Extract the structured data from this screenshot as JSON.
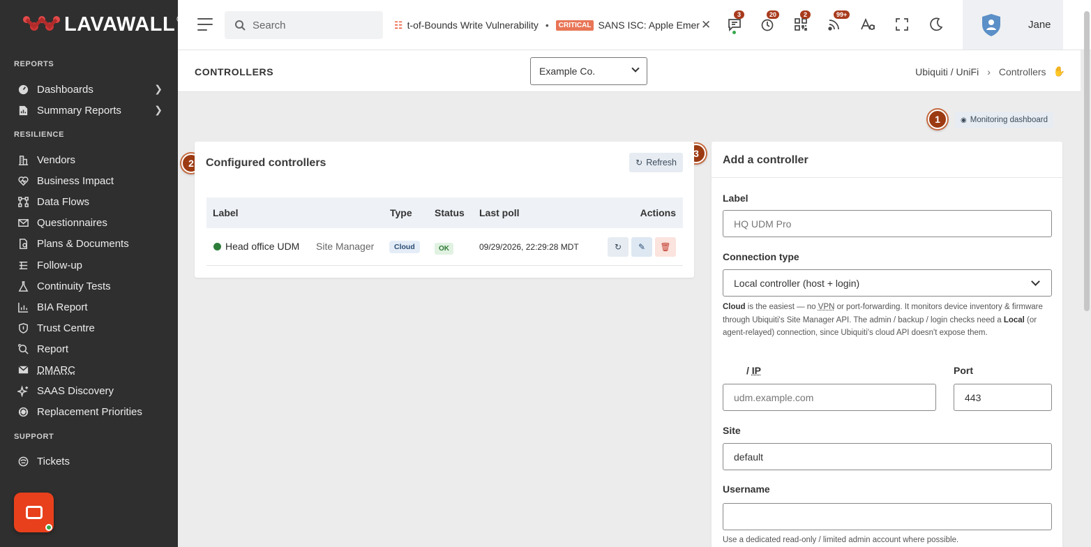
{
  "brand": {
    "name": "LAVAWALL",
    "reg": "®"
  },
  "sidebar": {
    "sections": [
      {
        "title": "REPORTS"
      },
      {
        "title": "RESILIENCE"
      },
      {
        "title": "SUPPORT"
      }
    ],
    "items": [
      {
        "label": "Dashboards",
        "icon": "dashboard-icon"
      },
      {
        "label": "Summary Reports",
        "icon": "report-icon"
      },
      {
        "label": "Vendors",
        "icon": "building-icon"
      },
      {
        "label": "Business Impact",
        "icon": "heart-icon"
      },
      {
        "label": "Data Flows",
        "icon": "flow-icon"
      },
      {
        "label": "Questionnaires",
        "icon": "mail-icon"
      },
      {
        "label": "Plans & Documents",
        "icon": "document-icon"
      },
      {
        "label": "Follow-up",
        "icon": "list-icon"
      },
      {
        "label": "Continuity Tests",
        "icon": "flask-icon"
      },
      {
        "label": "BIA Report",
        "icon": "chart-icon"
      },
      {
        "label": "Trust Centre",
        "icon": "shield-icon"
      },
      {
        "label": "Report",
        "icon": "search-icon"
      },
      {
        "label": "DMARC",
        "icon": "envelope-check-icon"
      },
      {
        "label": "SAAS Discovery",
        "icon": "sparkle-icon"
      },
      {
        "label": "Replacement Priorities",
        "icon": "cycle-icon"
      },
      {
        "label": "Tickets",
        "icon": "ticket-icon"
      }
    ]
  },
  "topbar": {
    "search_placeholder": "Search",
    "ticker_item_1": "t-of-Bounds Write Vulnerability",
    "ticker_badge": "CRITICAL",
    "ticker_item_2": "SANS ISC: Apple Emer",
    "badges": {
      "messages": "3",
      "alerts": "20",
      "scan": "2",
      "feeds": "99+"
    },
    "user_name": "Jane"
  },
  "page": {
    "title": "CONTROLLERS",
    "company": "Example Co.",
    "breadcrumb": {
      "parent": "Ubiquiti / UniFi",
      "current": "Controllers"
    },
    "monitoring_button": "Monitoring dashboard",
    "steps": [
      "1",
      "2",
      "3"
    ]
  },
  "controllers": {
    "title": "Configured controllers",
    "refresh_label": "Refresh",
    "columns": {
      "label": "Label",
      "type": "Type",
      "status": "Status",
      "last_poll": "Last poll",
      "actions": "Actions"
    },
    "rows": [
      {
        "label": "Head office UDM",
        "source": "Site Manager",
        "type": "Cloud",
        "status": "OK",
        "last_poll": "09/29/2026, 22:29:28 MDT"
      }
    ]
  },
  "add_controller": {
    "title": "Add a controller",
    "label_field": {
      "label": "Label",
      "placeholder": "HQ UDM Pro"
    },
    "connection_type": {
      "label": "Connection type",
      "value": "Local controller (host + login)"
    },
    "help": {
      "cloud": "Cloud",
      "p1": " is the easiest — no ",
      "vpn": "VPN",
      "p2": " or port-forwarding. It monitors device inventory & firmware through Ubiquiti's Site Manager API. The admin / backup / login checks need a ",
      "local": "Local",
      "p3": " (or agent-relayed) connection, since Ubiquiti's cloud API doesn't expose them."
    },
    "host_field": {
      "label_prefix": "/ ",
      "label_ip": "IP",
      "placeholder": "udm.example.com"
    },
    "port_field": {
      "label": "Port",
      "value": "443"
    },
    "site_field": {
      "label": "Site",
      "value": "default"
    },
    "username_field": {
      "label": "Username",
      "value": ""
    },
    "username_help": "Use a dedicated read-only / limited admin account where possible."
  },
  "colors": {
    "sidebar_bg": "#2f2f2f",
    "accent": "#e8401c",
    "step_marker": "#9c3a12"
  }
}
